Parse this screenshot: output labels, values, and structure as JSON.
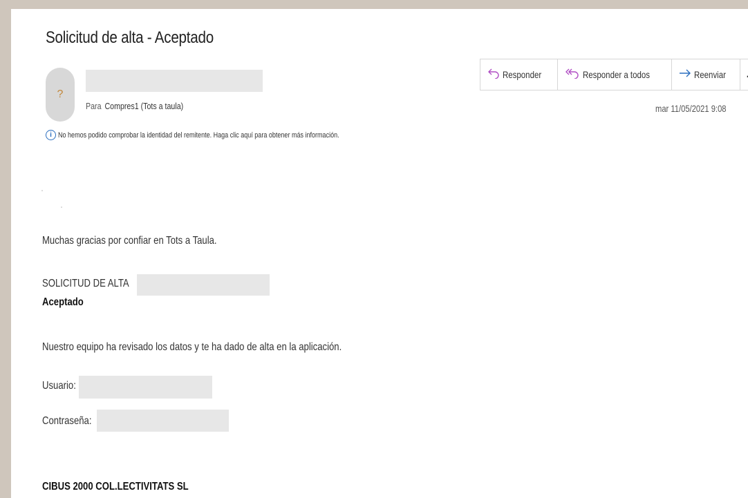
{
  "email": {
    "subject": "Solicitud de alta - Aceptado",
    "avatar_glyph": "?",
    "to_prefix": "Para",
    "to_name": "Compres1 (Tots a taula)",
    "warning": "No hemos podido comprobar la identidad del remitente. Haga clic aquí para obtener más información.",
    "date": "mar 11/05/2021 9:08"
  },
  "toolbar": {
    "reply_label": "Responder",
    "reply_all_label": "Responder a todos",
    "forward_label": "Reenviar",
    "more_label": "..."
  },
  "body": {
    "thanks": "Muchas gracias por confiar en Tots a Taula.",
    "request_heading": "SOLICITUD DE ALTA",
    "status": "Aceptado",
    "message": "Nuestro equipo ha revisado los datos y te ha dado de alta en la aplicación.",
    "user_label": "Usuario:",
    "password_label": "Contraseña:",
    "company": "CIBUS 2000 COL.LECTIVITATS SL"
  },
  "colors": {
    "accent_purple": "#b04fc4",
    "accent_blue": "#2a6ebf",
    "avatar_glyph": "#c2873a"
  },
  "icons": [
    "reply-icon",
    "reply-all-icon",
    "forward-icon",
    "more-icon",
    "info-icon"
  ]
}
